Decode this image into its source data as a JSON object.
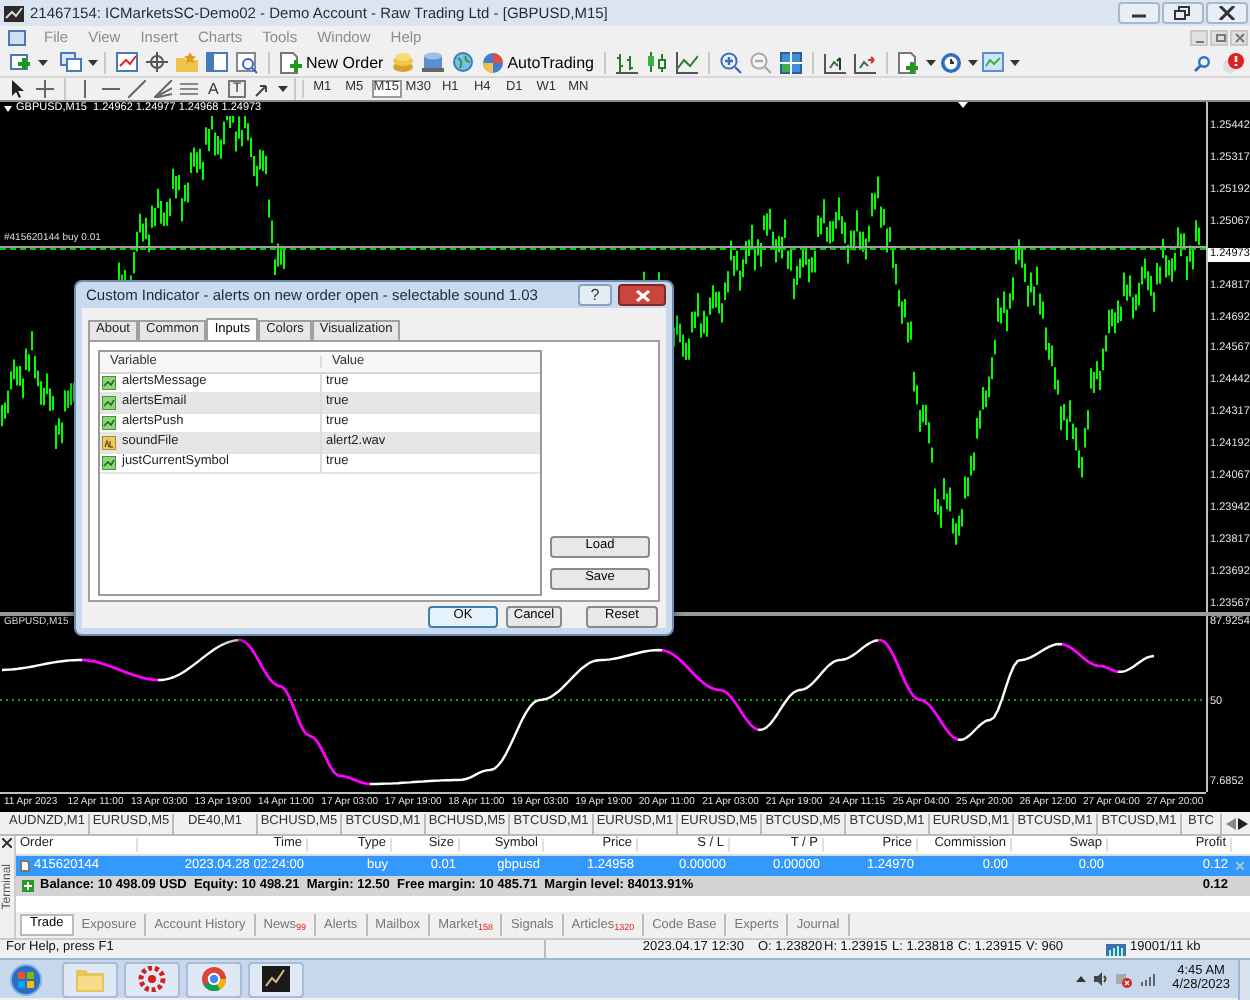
{
  "window": {
    "title": "21467154: ICMarketsSC-Demo02 - Demo Account - Raw Trading Ltd - [GBPUSD,M15]"
  },
  "menu": [
    "File",
    "View",
    "Insert",
    "Charts",
    "Tools",
    "Window",
    "Help"
  ],
  "toolbar": {
    "new_order": "New Order",
    "autotrading": "AutoTrading"
  },
  "drawing_tools": {
    "text_tool": "A",
    "label_tool": "T"
  },
  "timeframes": [
    {
      "label": "M1",
      "selected": false
    },
    {
      "label": "M5",
      "selected": false
    },
    {
      "label": "M15",
      "selected": true
    },
    {
      "label": "M30",
      "selected": false
    },
    {
      "label": "H1",
      "selected": false
    },
    {
      "label": "H4",
      "selected": false
    },
    {
      "label": "D1",
      "selected": false
    },
    {
      "label": "W1",
      "selected": false
    },
    {
      "label": "MN",
      "selected": false
    }
  ],
  "chart": {
    "header": "GBPUSD,M15  1.24962 1.24977 1.24968 1.24973",
    "order_line": "#415620144 buy 0.01",
    "price_ticks": [
      {
        "label": "1.25442",
        "kind": "tick"
      },
      {
        "label": "1.25317",
        "kind": "tick"
      },
      {
        "label": "1.25192",
        "kind": "tick"
      },
      {
        "label": "1.25067",
        "kind": "tick"
      },
      {
        "label": "1.24973",
        "kind": "current"
      },
      {
        "label": "1.24817",
        "kind": "tick"
      },
      {
        "label": "1.24692",
        "kind": "tick"
      },
      {
        "label": "1.24567",
        "kind": "tick"
      },
      {
        "label": "1.24442",
        "kind": "tick"
      },
      {
        "label": "1.24317",
        "kind": "tick"
      },
      {
        "label": "1.24192",
        "kind": "tick"
      },
      {
        "label": "1.24067",
        "kind": "tick"
      },
      {
        "label": "1.23942",
        "kind": "tick"
      },
      {
        "label": "1.23817",
        "kind": "tick"
      },
      {
        "label": "1.23692",
        "kind": "tick"
      },
      {
        "label": "1.23567",
        "kind": "tick"
      }
    ],
    "indicator": {
      "label": "GBPUSD,M15",
      "ticks": [
        "87.9254",
        "50",
        "7.6852"
      ]
    },
    "time_ticks": [
      "11 Apr 2023",
      "12 Apr 11:00",
      "13 Apr 03:00",
      "13 Apr 19:00",
      "14 Apr 11:00",
      "17 Apr 03:00",
      "17 Apr 19:00",
      "18 Apr 11:00",
      "19 Apr 03:00",
      "19 Apr 19:00",
      "20 Apr 11:00",
      "21 Apr 03:00",
      "21 Apr 19:00",
      "24 Apr 11:15",
      "25 Apr 04:00",
      "25 Apr 20:00",
      "26 Apr 12:00",
      "27 Apr 04:00",
      "27 Apr 20:00"
    ]
  },
  "chart_tabs": [
    "AUDNZD,M1",
    "EURUSD,M5",
    "DE40,M1",
    "BCHUSD,M5",
    "BTCUSD,M1",
    "BCHUSD,M5",
    "BTCUSD,M1",
    "EURUSD,M1",
    "EURUSD,M5",
    "BTCUSD,M5",
    "BTCUSD,M1",
    "EURUSD,M1",
    "BTCUSD,M1",
    "BTCUSD,M1",
    "BTC"
  ],
  "dialog": {
    "title": "Custom Indicator - alerts on new order open - selectable sound 1.03",
    "help": "?",
    "tabs": [
      {
        "label": "About",
        "selected": false
      },
      {
        "label": "Common",
        "selected": false
      },
      {
        "label": "Inputs",
        "selected": true
      },
      {
        "label": "Colors",
        "selected": false
      },
      {
        "label": "Visualization",
        "selected": false
      }
    ],
    "columns": [
      "Variable",
      "Value"
    ],
    "inputs": [
      {
        "variable": "alertsMessage",
        "value": "true",
        "kind": "bool"
      },
      {
        "variable": "alertsEmail",
        "value": "true",
        "kind": "bool"
      },
      {
        "variable": "alertsPush",
        "value": "true",
        "kind": "bool"
      },
      {
        "variable": "soundFile",
        "value": "alert2.wav",
        "kind": "string"
      },
      {
        "variable": "justCurrentSymbol",
        "value": "true",
        "kind": "bool"
      }
    ],
    "side_buttons": [
      "Load",
      "Save"
    ],
    "buttons": [
      "OK",
      "Cancel",
      "Reset"
    ]
  },
  "terminal": {
    "label": "Terminal",
    "columns": [
      "Order",
      "Time",
      "Type",
      "Size",
      "Symbol",
      "Price",
      "S / L",
      "T / P",
      "Price",
      "Commission",
      "Swap",
      "Profit"
    ],
    "rows": [
      {
        "cells": [
          "415620144",
          "2023.04.28 02:24:00",
          "buy",
          "0.01",
          "gbpusd",
          "1.24958",
          "0.00000",
          "0.00000",
          "1.24970",
          "0.00",
          "0.00",
          "0.12"
        ],
        "selected": true
      }
    ],
    "balance": "Balance: 10 498.09 USD  Equity: 10 498.21  Margin: 12.50  Free margin: 10 485.71  Margin level: 84013.91%",
    "balance_profit": "0.12",
    "tabs": [
      {
        "label": "Trade",
        "selected": true
      },
      {
        "label": "Exposure",
        "selected": false
      },
      {
        "label": "Account History",
        "selected": false
      },
      {
        "label": "News",
        "count": "99",
        "selected": false
      },
      {
        "label": "Alerts",
        "selected": false
      },
      {
        "label": "Mailbox",
        "selected": false
      },
      {
        "label": "Market",
        "count": "158",
        "selected": false
      },
      {
        "label": "Signals",
        "selected": false
      },
      {
        "label": "Articles",
        "count": "1320",
        "selected": false
      },
      {
        "label": "Code Base",
        "selected": false
      },
      {
        "label": "Experts",
        "selected": false
      },
      {
        "label": "Journal",
        "selected": false
      }
    ]
  },
  "status_bar": [
    "For Help, press F1",
    "2023.04.17 12:30",
    "O: 1.23820",
    "H: 1.23915",
    "L: 1.23818",
    "C: 1.23915",
    "V: 960",
    "19001/11 kb"
  ],
  "taskbar": {
    "time": "4:45 AM",
    "date": "4/28/2023"
  }
}
